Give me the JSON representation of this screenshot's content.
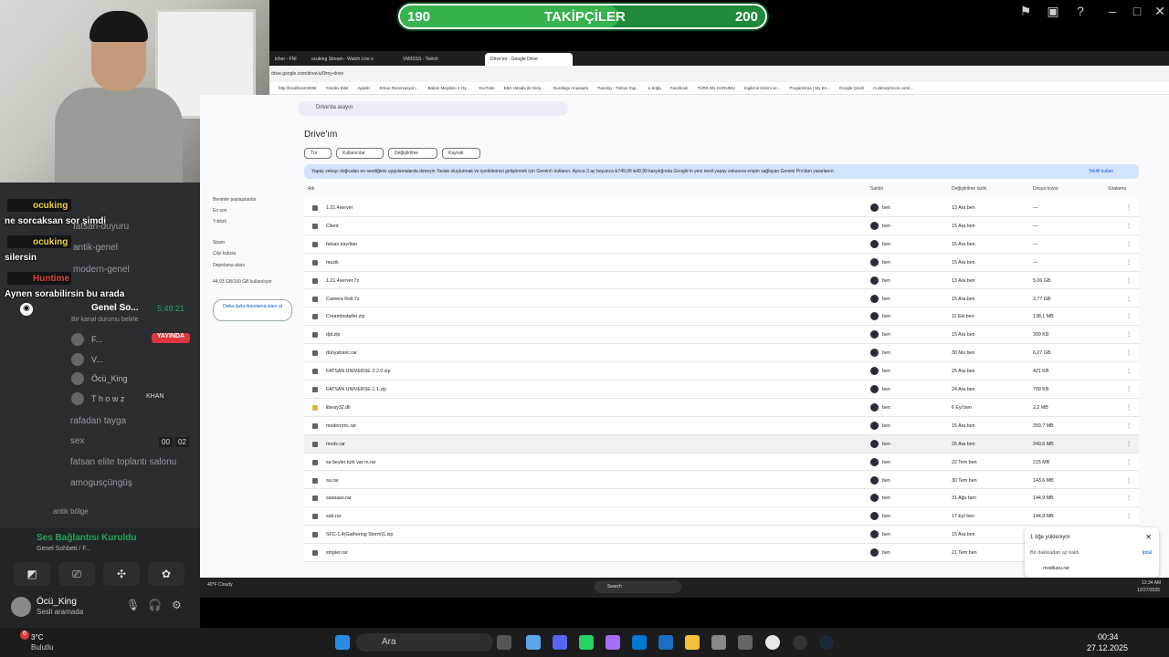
{
  "overlay": {
    "progress": {
      "current": "190",
      "label": "TAKİPÇİLER",
      "goal": "200",
      "fraction": 0.6
    }
  },
  "browser": {
    "tabs": [
      "tcher - FNI",
      "ocuking Stream - Watch Live o",
      "VM3SSS - Twitch",
      "Drive'ım - Google Drive"
    ],
    "url": "drive.google.com/drive/u/0/my-drive",
    "bookmarks": [
      "http://localhost:5005/",
      "Yandex.Bilet",
      "Apartic",
      "Erkan Rezervasyon...",
      "Bakan Meydanı 4 Oy...",
      "YouTube",
      "EBA Hesabı ile Giriş...",
      "Durdingo Anasayfa",
      "Tusenig - Türkçe İngi...",
      "e-doğa",
      "Facebook",
      "TÜRK DİL KURUMU",
      "İngilizce Dizimi ve...",
      "Progamlıma | My En...",
      "Google Çeviri",
      "m.deneyimcon.com/..."
    ],
    "bookmarks_right": "Tüm Yer İşaretleri"
  },
  "drive": {
    "search_placeholder": "Drive'da arayın",
    "title": "Drive'ım",
    "filters": [
      "Tür",
      "Kullanıcılar",
      "Değiştirilme",
      "Kaynak"
    ],
    "banner": "Yapay zekayı doğrudan en sevdiğiniz uygulamalarda deneyin  Taslak oluşturmak ve içeriklerinizi geliştirmek için Gemini'ı kullanın. Ayrıca 3 ay boyunca ₺749,99 ₺49,99 karşılığında Google'ın yeni nesil yapay zekasına erişim sağlayan Gemini Pro'dan yararlanın.",
    "banner_action": "Teklifi kullan",
    "columns": {
      "name": "Adı",
      "owner": "Sahibi",
      "modified": "Değiştirilme tarihi",
      "size": "Dosya boyut",
      "sort": "Sıralama"
    },
    "sidenav": [
      "Benimle paylaşılanlar",
      "En son",
      "Yıldızlı",
      "Spam",
      "Çöp kutusu",
      "Depolama alanı",
      "44,93 GB/100 GB kullanılıyor"
    ],
    "storage_button": "Daha fazla depolama alanı al",
    "rows": [
      {
        "name": "1.21.4server",
        "type": "folder",
        "owner": "ben",
        "date": "13 Ara ben",
        "size": "—"
      },
      {
        "name": "Client",
        "type": "folder",
        "owner": "ben",
        "date": "15 Ara ben",
        "size": "—"
      },
      {
        "name": "fatsan kayıtları",
        "type": "folder",
        "owner": "ben",
        "date": "15 Ara ben",
        "size": "—"
      },
      {
        "name": "muzik",
        "type": "folder",
        "owner": "ben",
        "date": "15 Ara ben",
        "size": "—"
      },
      {
        "name": "1.21.4server.7z",
        "type": "file",
        "owner": "ben",
        "date": "13 Ara ben",
        "size": "5,06 GB"
      },
      {
        "name": "Camera Roll.7z",
        "type": "file",
        "owner": "ben",
        "date": "15 Ara ben",
        "size": "2,77 GB"
      },
      {
        "name": "CreamInstaller.zip",
        "type": "file",
        "owner": "ben",
        "date": "11 Eki ben",
        "size": "138,1 MB"
      },
      {
        "name": "dpi.zip",
        "type": "file",
        "owner": "ben",
        "date": "15 Ara ben",
        "size": "309 KB"
      },
      {
        "name": "dünyaharic.rar",
        "type": "file",
        "owner": "ben",
        "date": "30 Nis ben",
        "size": "6,27 GB"
      },
      {
        "name": "FATSAN UNIVERSE 2-2.0.zip",
        "type": "file",
        "owner": "ben",
        "date": "25 Ara ben",
        "size": "421 KB"
      },
      {
        "name": "FATSAN UNIVERSE-1.1.zip",
        "type": "file",
        "owner": "ben",
        "date": "24 Ara ben",
        "size": "709 KB"
      },
      {
        "name": "libeay32.dll",
        "type": "dll",
        "owner": "ben",
        "date": "6 Eyl ben",
        "size": "2,2 MB"
      },
      {
        "name": "modernmc.rar",
        "type": "file",
        "owner": "ben",
        "date": "15 Ara ben",
        "size": "359,7 MB"
      },
      {
        "name": "mods.rar",
        "type": "file",
        "owner": "ben",
        "date": "25 Ara ben",
        "size": "340,6 MB"
      },
      {
        "name": "sa beyler türk var m.rar",
        "type": "file",
        "owner": "ben",
        "date": "22 Tem ben",
        "size": "215 MB"
      },
      {
        "name": "sa.rar",
        "type": "file",
        "owner": "ben",
        "date": "30 Tem ben",
        "size": "143,6 MB"
      },
      {
        "name": "saasaas.rar",
        "type": "file",
        "owner": "ben",
        "date": "31 Ağu ben",
        "size": "144,9 MB"
      },
      {
        "name": "sab.rar",
        "type": "file",
        "owner": "ben",
        "date": "17 Eyl ben",
        "size": "144,9 MB"
      },
      {
        "name": "SFC-1.4(Gathering Storm)1.zip",
        "type": "file",
        "owner": "ben",
        "date": "15 Ara ben",
        "size": "144,9 MB"
      },
      {
        "name": "smpler.rar",
        "type": "file",
        "owner": "ben",
        "date": "21 Tem ben",
        "size": "144,9 MB"
      }
    ],
    "upload": {
      "title": "1 öğe yükleniyor",
      "status": "Bir dakikadan az kaldı",
      "cancel": "İptal",
      "file": "modlusu.rar"
    }
  },
  "inner_taskbar": {
    "weather": "40°F Cloudy",
    "search": "Search",
    "time": "12:34 AM",
    "date": "12/27/2025",
    "lang": "ENG TRQ"
  },
  "discord": {
    "chat": [
      {
        "user": "ocuking",
        "text": "ne sorcaksan sor şimdi"
      },
      {
        "user": "ocuking",
        "text": "silersin"
      },
      {
        "user": "Huntime",
        "text": "Aynen sorabilirsin bu arada"
      }
    ],
    "channels_top": [
      "fatsan-duyuru",
      "antik-genel",
      "modern-genel"
    ],
    "voice_channel": {
      "name": "Genel So...",
      "timer": "5:49:21",
      "sub": "Bir kanal durumu belirle",
      "live": "YAYINDA"
    },
    "members": [
      "F...",
      "V...",
      "Öcü_King",
      "T h o w z"
    ],
    "member_tag": "KHAN",
    "voice_channels": [
      "rafadan tayga",
      "sex",
      "fatsan elite toplantı salonu",
      "amogusçüngüş"
    ],
    "sex_counts": [
      "00",
      "02"
    ],
    "category": "antik bölge",
    "connection": {
      "title": "Ses Bağlantısı Kuruldu",
      "sub": "Genel Sohbeti / F..."
    },
    "user": {
      "name": "Öcü_King",
      "status": "Sesli aramada"
    }
  },
  "windows": {
    "search": "Ara",
    "weather_temp": "3°C",
    "weather_desc": "Bulutlu",
    "badge": "6",
    "time": "00:34",
    "date": "27.12.2025"
  },
  "colors": {
    "drive_bg": "#f8fafd",
    "discord_bg": "#2b2d31",
    "green": "#23a55a",
    "live": "#da373c"
  }
}
